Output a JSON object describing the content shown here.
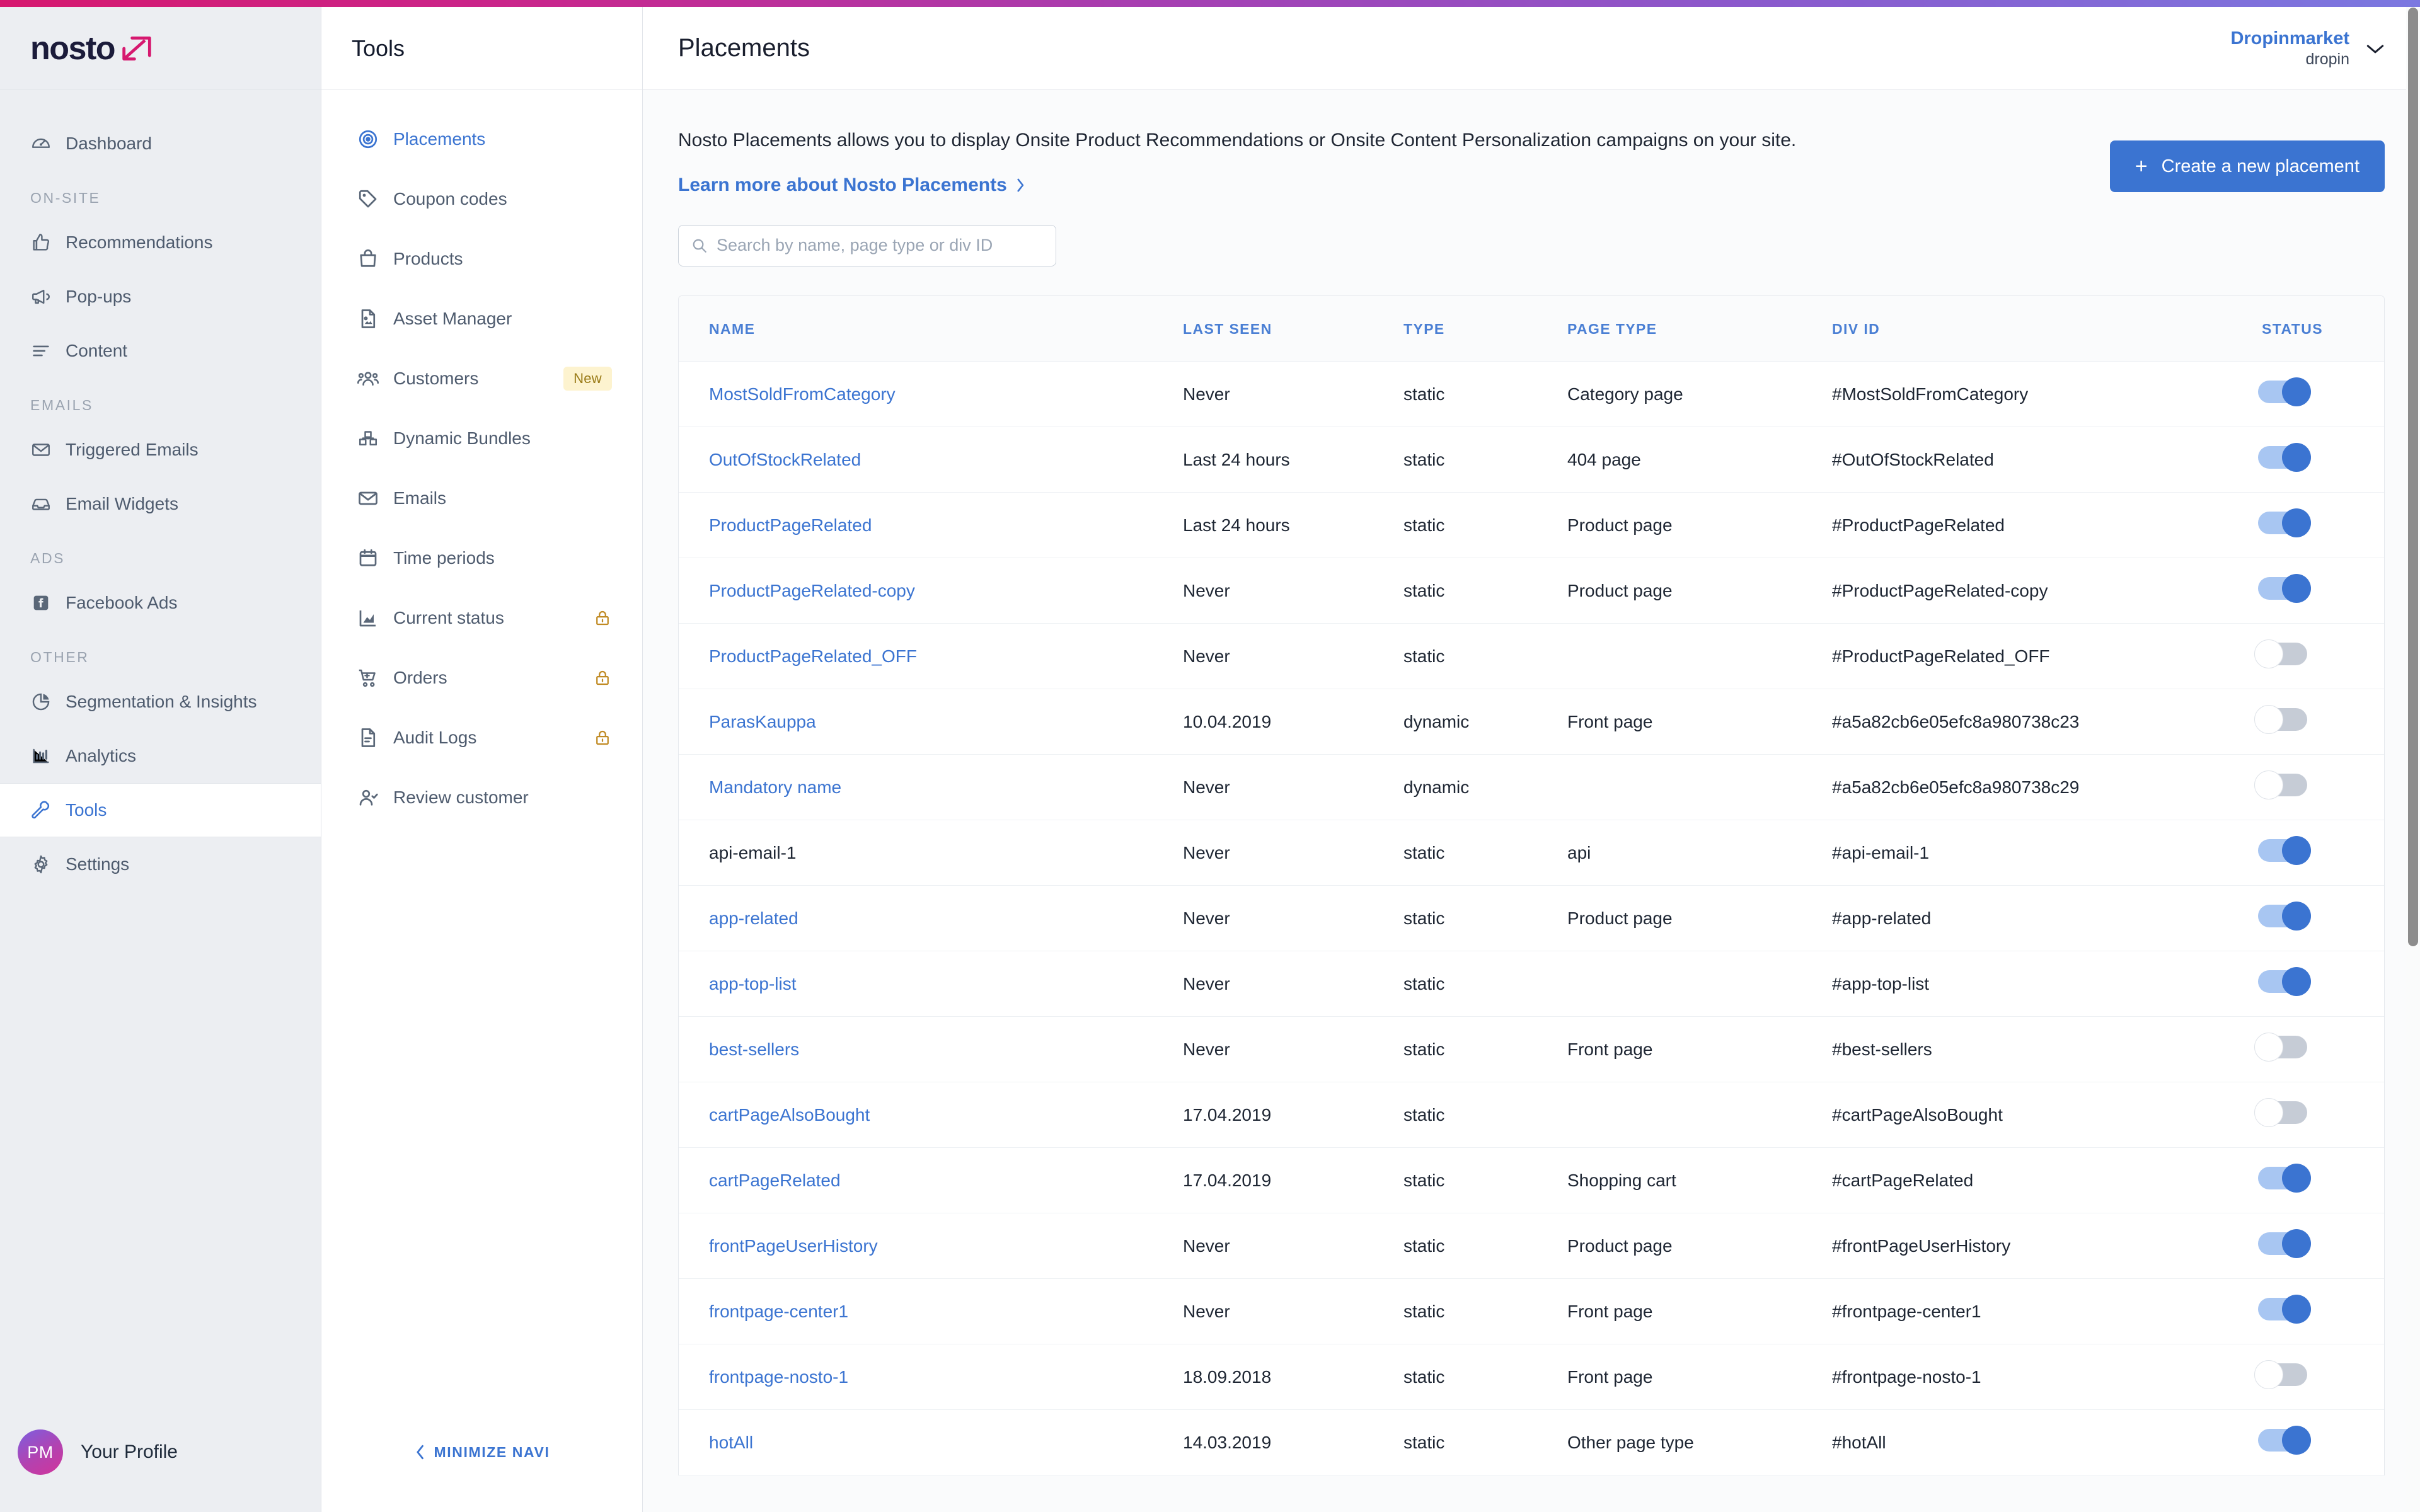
{
  "brand": {
    "logo_text": "nosto",
    "accent": "#3b74d1",
    "gradient_left": "#d6186f",
    "gradient_right": "#7b78e0"
  },
  "sidebar": {
    "items": [
      {
        "label": "Dashboard",
        "icon": "dashboard-gauge-icon",
        "group": null,
        "active": false
      },
      {
        "label": "ON-SITE",
        "type": "group"
      },
      {
        "label": "Recommendations",
        "icon": "thumbs-up-icon",
        "active": false
      },
      {
        "label": "Pop-ups",
        "icon": "megaphone-icon",
        "active": false
      },
      {
        "label": "Content",
        "icon": "list-lines-icon",
        "active": false
      },
      {
        "label": "EMAILS",
        "type": "group"
      },
      {
        "label": "Triggered Emails",
        "icon": "envelope-icon",
        "active": false
      },
      {
        "label": "Email Widgets",
        "icon": "inbox-icon",
        "active": false
      },
      {
        "label": "ADS",
        "type": "group"
      },
      {
        "label": "Facebook Ads",
        "icon": "facebook-icon",
        "active": false
      },
      {
        "label": "OTHER",
        "type": "group"
      },
      {
        "label": "Segmentation & Insights",
        "icon": "pie-chart-icon",
        "active": false
      },
      {
        "label": "Analytics",
        "icon": "bar-chart-icon",
        "active": false
      },
      {
        "label": "Tools",
        "icon": "wrench-icon",
        "active": true
      },
      {
        "label": "Settings",
        "icon": "gear-icon",
        "active": false
      }
    ],
    "profile": {
      "initials": "PM",
      "label": "Your Profile"
    }
  },
  "subnav": {
    "title": "Tools",
    "minimize_label": "MINIMIZE NAVI",
    "items": [
      {
        "label": "Placements",
        "icon": "target-icon",
        "active": true,
        "badge": null,
        "locked": false
      },
      {
        "label": "Coupon codes",
        "icon": "tag-icon",
        "active": false,
        "badge": null,
        "locked": false
      },
      {
        "label": "Products",
        "icon": "shopping-bag-icon",
        "active": false,
        "badge": null,
        "locked": false
      },
      {
        "label": "Asset Manager",
        "icon": "image-file-icon",
        "active": false,
        "badge": null,
        "locked": false
      },
      {
        "label": "Customers",
        "icon": "people-icon",
        "active": false,
        "badge": "New",
        "locked": false
      },
      {
        "label": "Dynamic Bundles",
        "icon": "bundles-icon",
        "active": false,
        "badge": null,
        "locked": false
      },
      {
        "label": "Emails",
        "icon": "envelope-icon",
        "active": false,
        "badge": null,
        "locked": false
      },
      {
        "label": "Time periods",
        "icon": "calendar-icon",
        "active": false,
        "badge": null,
        "locked": false
      },
      {
        "label": "Current status",
        "icon": "area-chart-icon",
        "active": false,
        "badge": null,
        "locked": true
      },
      {
        "label": "Orders",
        "icon": "shopping-cart-icon",
        "active": false,
        "badge": null,
        "locked": true
      },
      {
        "label": "Audit Logs",
        "icon": "document-icon",
        "active": false,
        "badge": null,
        "locked": true
      },
      {
        "label": "Review customer",
        "icon": "user-check-icon",
        "active": false,
        "badge": null,
        "locked": false
      }
    ]
  },
  "header": {
    "title": "Placements",
    "account_name": "Dropinmarket",
    "account_sub": "dropin"
  },
  "intro": {
    "text": "Nosto Placements allows you to display Onsite Product Recommendations or Onsite Content Personalization campaigns on your site.",
    "link_label": "Learn more about Nosto Placements",
    "create_button": "Create a new placement"
  },
  "search": {
    "placeholder": "Search by name, page type or div ID",
    "value": ""
  },
  "table": {
    "columns": [
      "NAME",
      "LAST SEEN",
      "TYPE",
      "PAGE TYPE",
      "DIV ID",
      "STATUS"
    ],
    "rows": [
      {
        "name": "MostSoldFromCategory",
        "link": true,
        "last_seen": "Never",
        "type": "static",
        "page_type": "Category page",
        "div_id": "#MostSoldFromCategory",
        "status": "on"
      },
      {
        "name": "OutOfStockRelated",
        "link": true,
        "last_seen": "Last 24 hours",
        "type": "static",
        "page_type": "404 page",
        "div_id": "#OutOfStockRelated",
        "status": "on"
      },
      {
        "name": "ProductPageRelated",
        "link": true,
        "last_seen": "Last 24 hours",
        "type": "static",
        "page_type": "Product page",
        "div_id": "#ProductPageRelated",
        "status": "on"
      },
      {
        "name": "ProductPageRelated-copy",
        "link": true,
        "last_seen": "Never",
        "type": "static",
        "page_type": "Product page",
        "div_id": "#ProductPageRelated-copy",
        "status": "on"
      },
      {
        "name": "ProductPageRelated_OFF",
        "link": true,
        "last_seen": "Never",
        "type": "static",
        "page_type": "",
        "div_id": "#ProductPageRelated_OFF",
        "status": "off"
      },
      {
        "name": "ParasKauppa",
        "link": true,
        "last_seen": "10.04.2019",
        "type": "dynamic",
        "page_type": "Front page",
        "div_id": "#a5a82cb6e05efc8a980738c23",
        "status": "off"
      },
      {
        "name": "Mandatory name",
        "link": true,
        "last_seen": "Never",
        "type": "dynamic",
        "page_type": "",
        "div_id": "#a5a82cb6e05efc8a980738c29",
        "status": "off"
      },
      {
        "name": "api-email-1",
        "link": false,
        "last_seen": "Never",
        "type": "static",
        "page_type": "api",
        "div_id": "#api-email-1",
        "status": "on"
      },
      {
        "name": "app-related",
        "link": true,
        "last_seen": "Never",
        "type": "static",
        "page_type": "Product page",
        "div_id": "#app-related",
        "status": "on"
      },
      {
        "name": "app-top-list",
        "link": true,
        "last_seen": "Never",
        "type": "static",
        "page_type": "",
        "div_id": "#app-top-list",
        "status": "on"
      },
      {
        "name": "best-sellers",
        "link": true,
        "last_seen": "Never",
        "type": "static",
        "page_type": "Front page",
        "div_id": "#best-sellers",
        "status": "off"
      },
      {
        "name": "cartPageAlsoBought",
        "link": true,
        "last_seen": "17.04.2019",
        "type": "static",
        "page_type": "",
        "div_id": "#cartPageAlsoBought",
        "status": "off"
      },
      {
        "name": "cartPageRelated",
        "link": true,
        "last_seen": "17.04.2019",
        "type": "static",
        "page_type": "Shopping cart",
        "div_id": "#cartPageRelated",
        "status": "on"
      },
      {
        "name": "frontPageUserHistory",
        "link": true,
        "last_seen": "Never",
        "type": "static",
        "page_type": "Product page",
        "div_id": "#frontPageUserHistory",
        "status": "on"
      },
      {
        "name": "frontpage-center1",
        "link": true,
        "last_seen": "Never",
        "type": "static",
        "page_type": "Front page",
        "div_id": "#frontpage-center1",
        "status": "on"
      },
      {
        "name": "frontpage-nosto-1",
        "link": true,
        "last_seen": "18.09.2018",
        "type": "static",
        "page_type": "Front page",
        "div_id": "#frontpage-nosto-1",
        "status": "off"
      },
      {
        "name": "hotAll",
        "link": true,
        "last_seen": "14.03.2019",
        "type": "static",
        "page_type": "Other page type",
        "div_id": "#hotAll",
        "status": "on"
      }
    ]
  }
}
